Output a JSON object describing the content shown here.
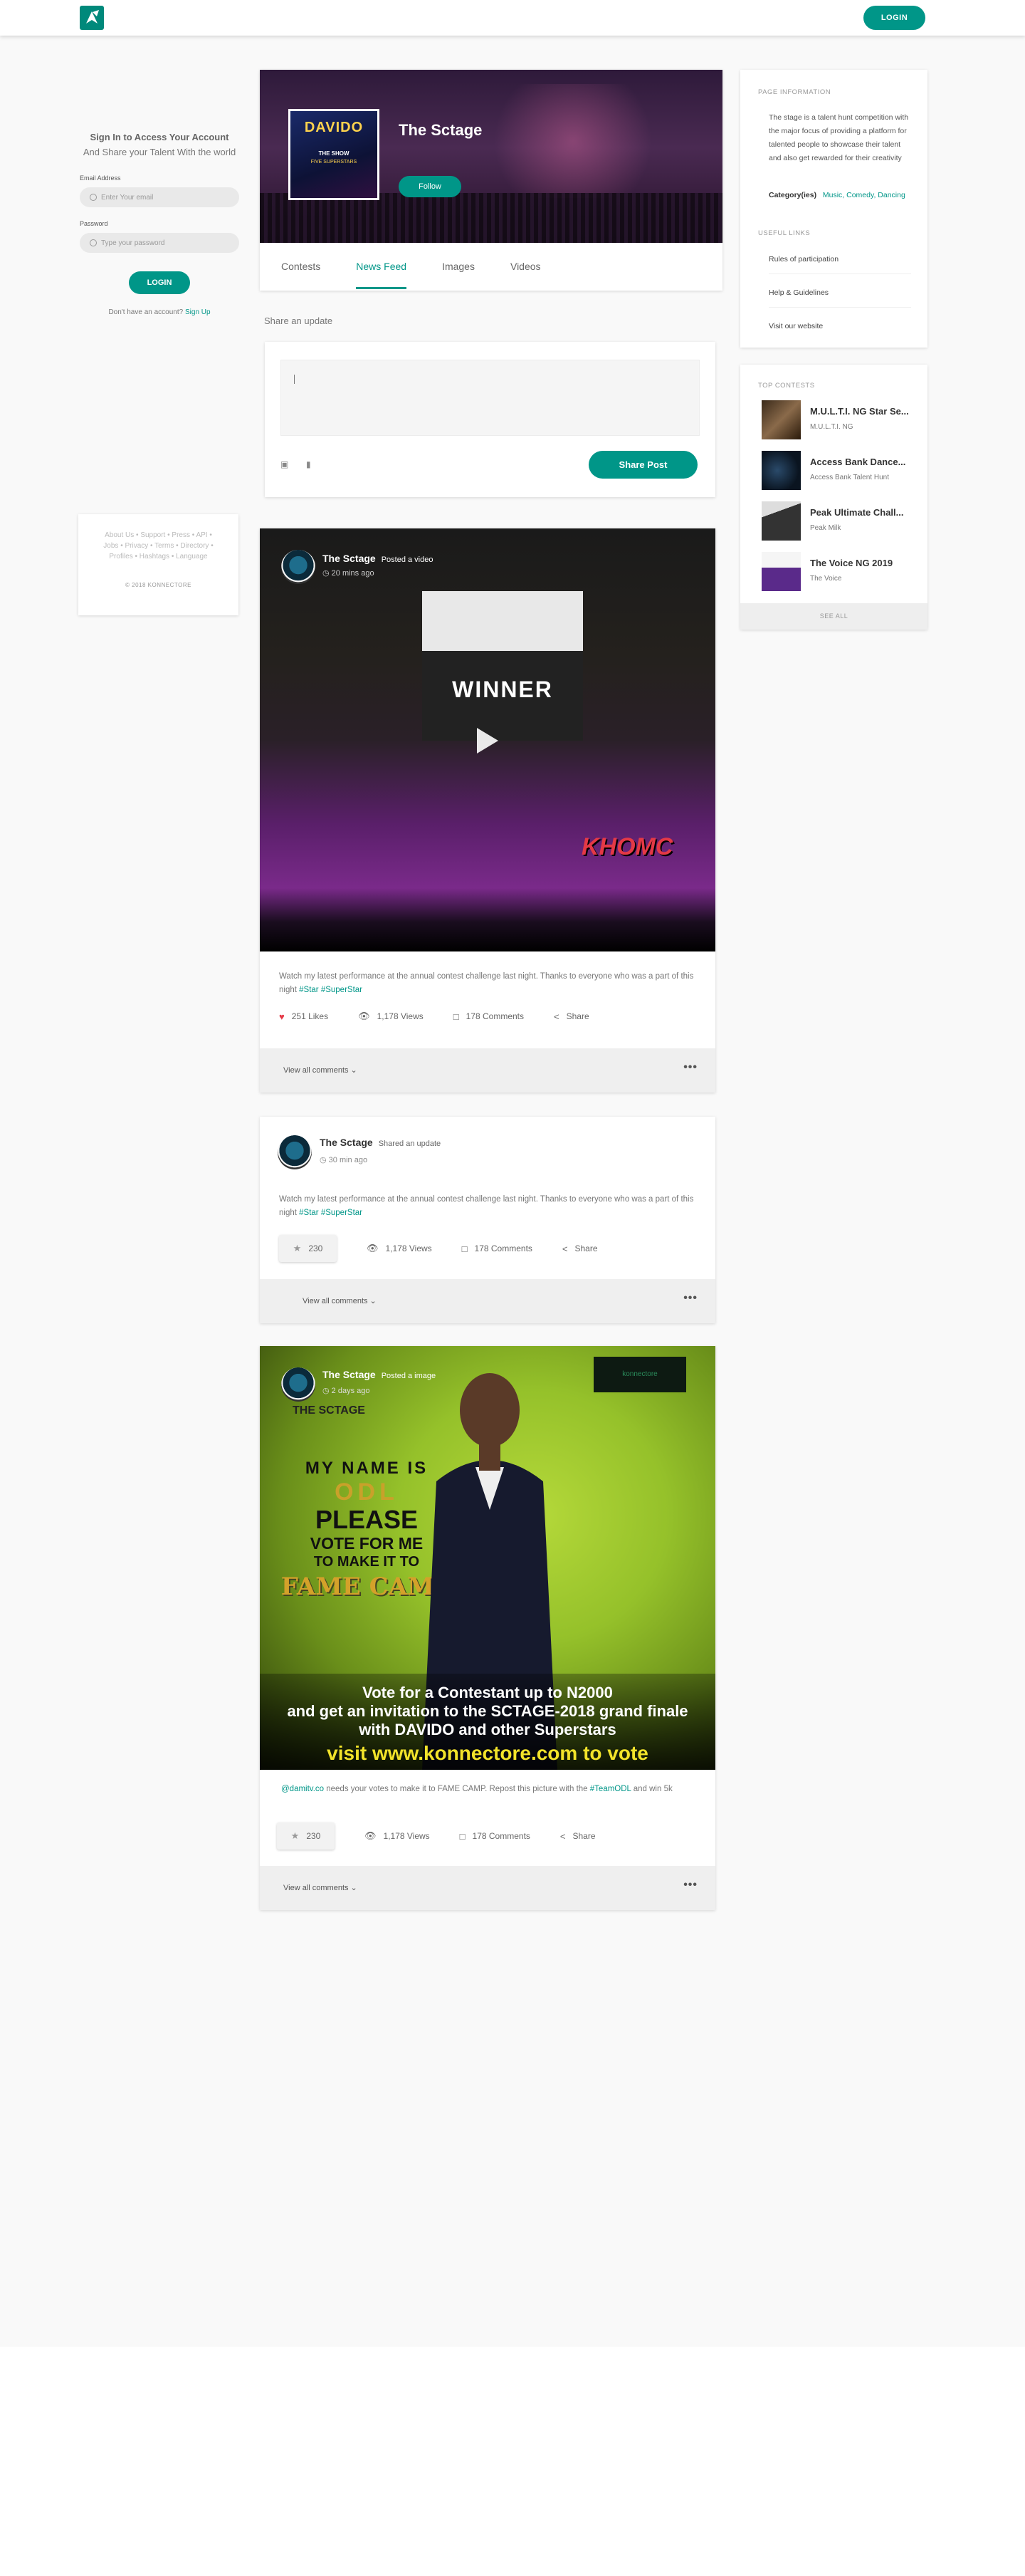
{
  "header": {
    "login_label": "LOGIN"
  },
  "login": {
    "title": "Sign In to Access Your Account",
    "subtitle": "And Share your Talent With the world",
    "email_label": "Email Address",
    "email_placeholder": "Enter Your email",
    "password_label": "Password",
    "password_placeholder": "Type your password",
    "button": "LOGIN",
    "no_account": "Don't have an account?",
    "signup": "Sign Up"
  },
  "footer": {
    "links": "About Us • Support • Press • API • Jobs • Privacy • Terms • Directory • Profiles • Hashtags • Language",
    "copyright": "© 2018 KONNECTORE"
  },
  "profile": {
    "name": "The Sctage",
    "follow": "Follow",
    "poster_title": "DAVIDO",
    "poster_line1": "THE SHOW",
    "poster_line2": "FIVE SUPERSTARS",
    "tabs": [
      "Contests",
      "News Feed",
      "Images",
      "Videos"
    ],
    "active_tab": "News Feed"
  },
  "composer": {
    "label": "Share an update",
    "share_button": "Share Post"
  },
  "posts": [
    {
      "author": "The Sctage",
      "action": "Posted a video",
      "time": "20 mins ago",
      "text": "Watch my latest performance at the annual contest challenge last night. Thanks to everyone who was a part of this night",
      "tags": "#Star #SuperStar",
      "likes": "251 Likes",
      "views": "1,178 Views",
      "comments": "178 Comments",
      "share": "Share",
      "view_comments": "View all comments",
      "media_text_1": "WINNER",
      "media_text_2": "KHOMC"
    },
    {
      "author": "The Sctage",
      "action": "Shared an update",
      "time": "30 min ago",
      "text": "Watch my latest performance at the annual contest challenge last night. Thanks to everyone who was a part of this night",
      "tags": "#Star #SuperStar",
      "likes": "230",
      "views": "1,178 Views",
      "comments": "178 Comments",
      "share": "Share",
      "view_comments": "View all comments"
    },
    {
      "author": "The Sctage",
      "action": "Posted a image",
      "time": "2 days ago",
      "mention": "@damitv.co",
      "text": "needs your votes to make it to FAME CAMP. Repost this picture with the",
      "tag": "#TeamODL",
      "text2": "and win 5k",
      "likes": "230",
      "views": "1,178 Views",
      "comments": "178 Comments",
      "share": "Share",
      "view_comments": "View all comments",
      "img_mark": "THE SCTAGE",
      "img_l1": "MY NAME IS",
      "img_l2": "ODL",
      "img_l3": "PLEASE",
      "img_l4": "VOTE FOR ME",
      "img_l5": "TO MAKE IT TO",
      "img_l6": "FAME CAMP",
      "img_b1": "Vote for a Contestant up to N2000",
      "img_b2": "and get an invitation to the SCTAGE-2018 grand finale",
      "img_b3": "with DAVIDO and other Superstars",
      "img_b4": "visit www.konnectore.com to vote",
      "img_logo": "konnectore"
    }
  ],
  "page_info": {
    "heading": "PAGE INFORMATION",
    "description": "The stage is a talent hunt competition with the major focus of providing a platform for talented people to showcase their talent and also get rewarded for their creativity",
    "category_label": "Category(ies)",
    "categories": "Music, Comedy, Dancing",
    "links_heading": "USEFUL LINKS",
    "links": [
      "Rules of participation",
      "Help & Guidelines",
      "Visit our website"
    ]
  },
  "top_contests": {
    "heading": "TOP CONTESTS",
    "items": [
      {
        "title": "M.U.L.T.I. NG Star Se...",
        "sub": "M.U.L.T.I. NG"
      },
      {
        "title": "Access Bank Dance...",
        "sub": "Access Bank Talent Hunt"
      },
      {
        "title": "Peak Ultimate Chall...",
        "sub": "Peak Milk"
      },
      {
        "title": "The Voice NG 2019",
        "sub": "The Voice"
      }
    ],
    "see_all": "SEE ALL"
  }
}
